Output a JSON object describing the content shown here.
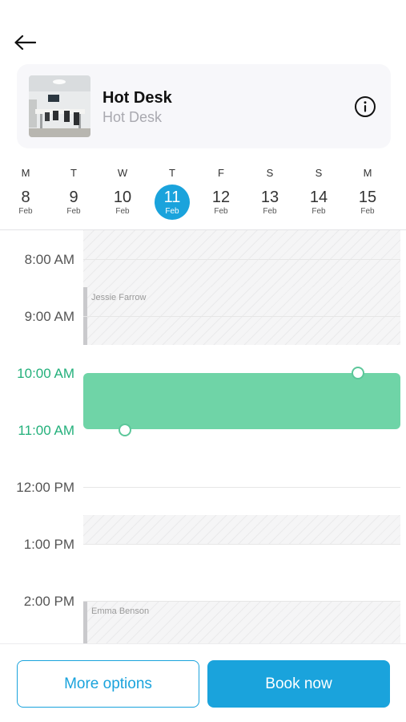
{
  "header": {
    "back_icon": "arrow-left-icon"
  },
  "resource": {
    "title": "Hot Desk",
    "subtitle": "Hot Desk",
    "info_icon": "info-circle-icon"
  },
  "calendar": {
    "days": [
      {
        "dow": "M",
        "num": "8",
        "month": "Feb",
        "selected": false
      },
      {
        "dow": "T",
        "num": "9",
        "month": "Feb",
        "selected": false
      },
      {
        "dow": "W",
        "num": "10",
        "month": "Feb",
        "selected": false
      },
      {
        "dow": "T",
        "num": "11",
        "month": "Feb",
        "selected": true
      },
      {
        "dow": "F",
        "num": "12",
        "month": "Feb",
        "selected": false
      },
      {
        "dow": "S",
        "num": "13",
        "month": "Feb",
        "selected": false
      },
      {
        "dow": "S",
        "num": "14",
        "month": "Feb",
        "selected": false
      },
      {
        "dow": "M",
        "num": "15",
        "month": "Feb",
        "selected": false
      }
    ],
    "selected_color": "#1aa3dc"
  },
  "timeline": {
    "hours": [
      "8:00 AM",
      "9:00 AM",
      "10:00 AM",
      "11:00 AM",
      "12:00 PM",
      "1:00 PM",
      "2:00 PM"
    ],
    "bookings": [
      {
        "name": "Jessie Farrow"
      },
      {
        "name": "Emma Benson"
      }
    ],
    "selection_color": "#6fd4a7",
    "active_label_color": "#23b07b"
  },
  "footer": {
    "more_options_label": "More options",
    "book_now_label": "Book now",
    "accent": "#1aa3dc"
  }
}
